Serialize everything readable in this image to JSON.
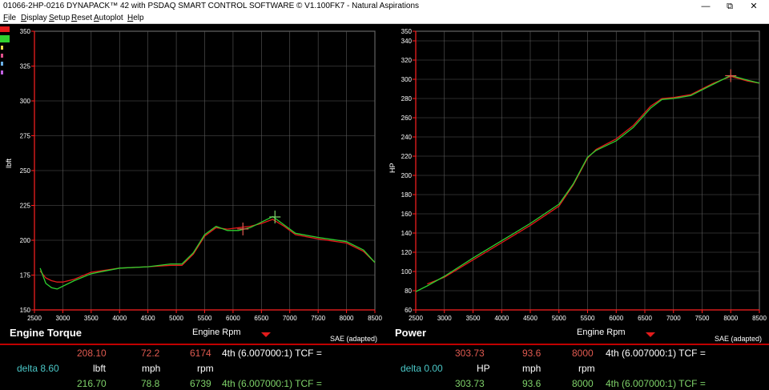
{
  "window": {
    "title": "01066-2HP-0216 DYNAPACK™ 42 with PSDAQ SMART CONTROL SOFTWARE © V1.100FK7 - Natural Aspirations",
    "minimize": "—",
    "maximize": "⧉",
    "close": "✕"
  },
  "menu": [
    "File",
    "Display",
    "Setup",
    "Reset",
    "Autoplot",
    "Help"
  ],
  "run_colors": [
    "#e31b1b",
    "#2fd12f"
  ],
  "run_marker_colors": [
    "#e6e04a",
    "#e0508c",
    "#6ab0e6",
    "#c060e0"
  ],
  "torque_chart": {
    "title": "Engine Torque",
    "x_axis_label": "Engine Rpm",
    "y_axis_label": "lbft",
    "correction": "SAE (adapted)",
    "color": "#ff2020",
    "chart_data": {
      "type": "line",
      "xlim": [
        2500,
        8500
      ],
      "ylim": [
        150,
        350
      ],
      "x_ticks": [
        "2500",
        "3000",
        "3500",
        "4000",
        "4500",
        "5000",
        "5500",
        "6000",
        "6500",
        "7000",
        "7500",
        "8000",
        "8500"
      ],
      "y_ticks": [
        "150",
        "175",
        "200",
        "225",
        "250",
        "275",
        "300",
        "325",
        "350"
      ],
      "grid": true,
      "series": [
        {
          "color": "#e31b1b",
          "x": [
            2600,
            2700,
            2800,
            2900,
            3000,
            3200,
            3500,
            4000,
            4500,
            4900,
            5100,
            5300,
            5500,
            5700,
            5900,
            6100,
            6300,
            6500,
            6700,
            6900,
            7100,
            7500,
            8000,
            8300,
            8500
          ],
          "y": [
            178,
            173,
            171,
            170,
            170,
            172,
            177,
            180,
            181,
            182,
            182,
            190,
            203,
            209,
            208,
            209,
            210,
            212,
            215,
            210,
            204,
            201,
            198,
            192,
            184
          ]
        },
        {
          "color": "#2fd12f",
          "x": [
            2600,
            2700,
            2800,
            2900,
            3000,
            3200,
            3500,
            4000,
            4500,
            4900,
            5100,
            5300,
            5500,
            5700,
            5900,
            6100,
            6300,
            6500,
            6700,
            6900,
            7100,
            7500,
            8000,
            8300,
            8500
          ],
          "y": [
            180,
            169,
            166,
            165,
            167,
            171,
            176,
            180,
            181,
            183,
            183,
            191,
            204,
            210,
            207,
            207,
            209,
            213,
            217,
            211,
            205,
            202,
            199,
            193,
            184
          ]
        }
      ],
      "cursors": [
        {
          "x": 6174,
          "y": 208.1,
          "color": "#e05a50"
        },
        {
          "x": 6739,
          "y": 216.7,
          "color": "#7fd36a"
        }
      ]
    }
  },
  "power_chart": {
    "title": "Power",
    "x_axis_label": "Engine Rpm",
    "y_axis_label": "HP",
    "correction": "SAE (adapted)",
    "color": "#ff2020",
    "chart_data": {
      "type": "line",
      "xlim": [
        2500,
        8500
      ],
      "ylim": [
        60,
        350
      ],
      "x_ticks": [
        "2500",
        "3000",
        "3500",
        "4000",
        "4500",
        "5000",
        "5500",
        "6000",
        "6500",
        "7000",
        "7500",
        "8000",
        "8500"
      ],
      "y_ticks": [
        "60",
        "80",
        "100",
        "120",
        "140",
        "160",
        "180",
        "200",
        "220",
        "240",
        "260",
        "280",
        "300",
        "320",
        "340",
        "350"
      ],
      "grid": true,
      "series": [
        {
          "color": "#e31b1b",
          "x": [
            2700,
            3000,
            3500,
            4000,
            4500,
            5000,
            5250,
            5500,
            5650,
            6000,
            6300,
            6600,
            6800,
            7000,
            7300,
            7700,
            8000,
            8300,
            8500
          ],
          "y": [
            87,
            94,
            112,
            130,
            148,
            168,
            190,
            218,
            227,
            238,
            252,
            272,
            280,
            281,
            284,
            296,
            303,
            298,
            296
          ]
        },
        {
          "color": "#2fd12f",
          "x": [
            2500,
            2700,
            3000,
            3500,
            4000,
            4500,
            5000,
            5250,
            5500,
            5650,
            6000,
            6300,
            6600,
            6800,
            7000,
            7300,
            7700,
            8000,
            8300,
            8500
          ],
          "y": [
            79,
            85,
            95,
            114,
            132,
            150,
            170,
            191,
            219,
            226,
            236,
            250,
            270,
            279,
            280,
            283,
            295,
            304,
            299,
            296
          ]
        }
      ],
      "cursors": [
        {
          "x": 8000,
          "y": 303.73,
          "color": "#e05a50"
        }
      ]
    }
  },
  "readouts": {
    "torque": {
      "run1": {
        "value": "208.10",
        "speed": "72.2",
        "rpm": "6174",
        "gear": "4th (6.007000:1) TCF ="
      },
      "units": {
        "delta": "delta 8.60",
        "value_unit": "lbft",
        "speed_unit": "mph",
        "rpm_unit": "rpm"
      },
      "run2": {
        "value": "216.70",
        "speed": "78.8",
        "rpm": "6739",
        "gear": "4th (6.007000:1) TCF ="
      }
    },
    "power": {
      "run1": {
        "value": "303.73",
        "speed": "93.6",
        "rpm": "8000",
        "gear": "4th (6.007000:1) TCF ="
      },
      "units": {
        "delta": "delta 0.00",
        "value_unit": "HP",
        "speed_unit": "mph",
        "rpm_unit": "rpm"
      },
      "run2": {
        "value": "303.73",
        "speed": "93.6",
        "rpm": "8000",
        "gear": "4th (6.007000:1) TCF ="
      }
    }
  }
}
